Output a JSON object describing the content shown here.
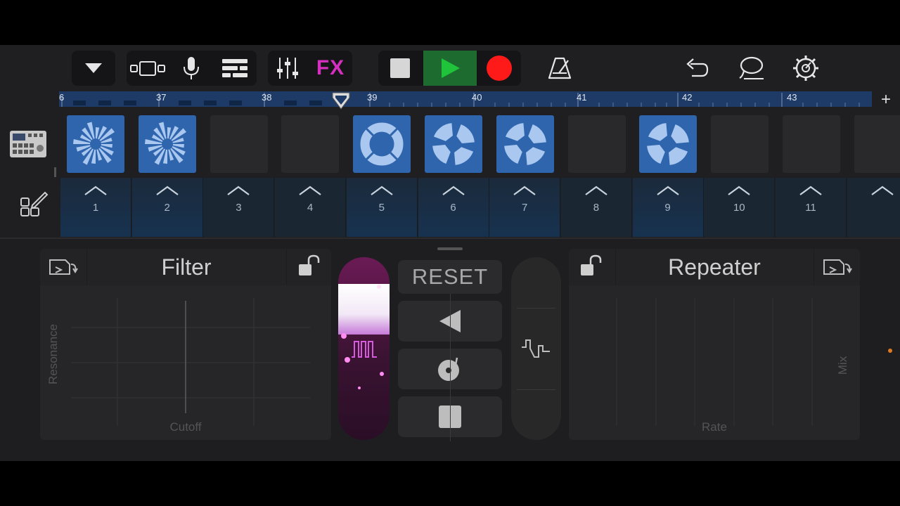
{
  "toolbar": {
    "fx_label": "FX"
  },
  "ruler": {
    "bars": [
      "6",
      "37",
      "38",
      "39",
      "40",
      "41",
      "42",
      "43"
    ]
  },
  "grid": {
    "cells": [
      {
        "state": "playing",
        "icon": "loop-spinner-icon"
      },
      {
        "state": "playing",
        "icon": "loop-spinner-icon"
      },
      {
        "state": "empty"
      },
      {
        "state": "empty"
      },
      {
        "state": "queued",
        "icon": "loop-ring-icon"
      },
      {
        "state": "queued",
        "icon": "loop-quarter-icon"
      },
      {
        "state": "queued",
        "icon": "loop-quarter-icon"
      },
      {
        "state": "empty"
      },
      {
        "state": "queued",
        "icon": "loop-quarter-icon"
      },
      {
        "state": "empty"
      },
      {
        "state": "empty"
      },
      {
        "state": "empty"
      }
    ],
    "column_triggers": [
      "1",
      "2",
      "3",
      "4",
      "5",
      "6",
      "7",
      "8",
      "9",
      "10",
      "11",
      ""
    ]
  },
  "filter_panel": {
    "title": "Filter",
    "x_axis": "Cutoff",
    "y_axis": "Resonance"
  },
  "center": {
    "reset_label": "RESET"
  },
  "repeater_panel": {
    "title": "Repeater",
    "x_axis": "Rate",
    "y_axis": "Mix"
  },
  "colors": {
    "accent_blue": "#2e65ad",
    "fx_magenta": "#d42fbe",
    "play_green": "#1fc43a",
    "record_red": "#ff1a1a"
  }
}
